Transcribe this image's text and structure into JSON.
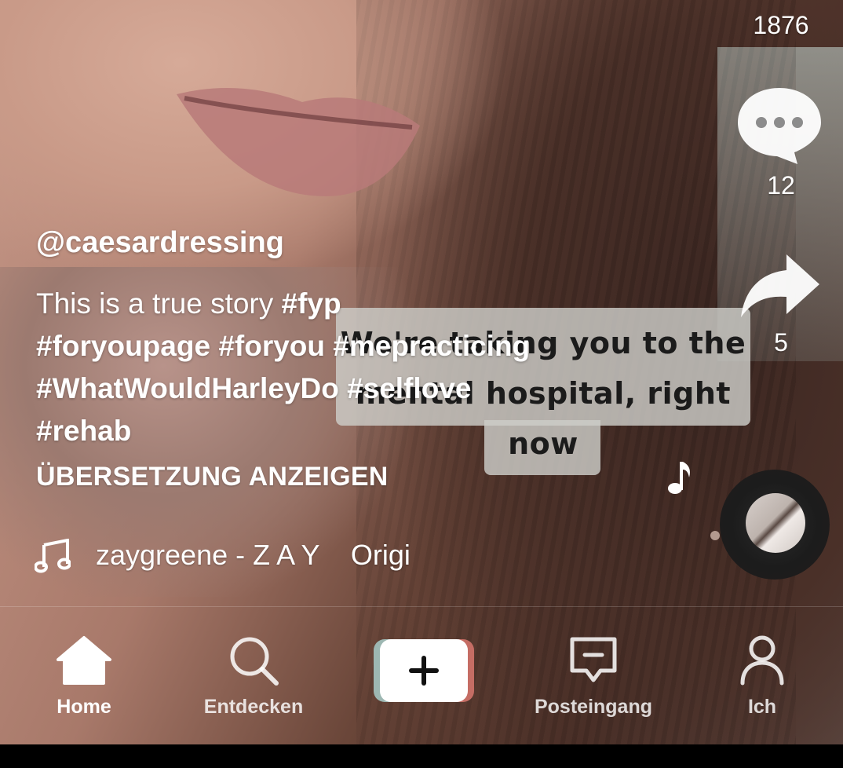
{
  "video": {
    "caption_sticker": {
      "line1": "We're taking you to the",
      "line2": "mental hospital, right",
      "line3": "now"
    }
  },
  "rail": {
    "like_count": "1876",
    "comment_count": "12",
    "share_count": "5"
  },
  "post": {
    "username": "@caesardressing",
    "description_text": "This is a true story ",
    "hashtags": [
      "#fyp",
      "#foryoupage",
      "#foryou",
      "#mepracticing",
      "#WhatWouldHarleyDo",
      "#selflove",
      "#rehab"
    ],
    "translate_label": "ÜBERSETZUNG ANZEIGEN",
    "music": "zaygreene - Z A Y    Origi"
  },
  "nav": {
    "home": "Home",
    "discover": "Entdecken",
    "inbox": "Posteingang",
    "me": "Ich"
  },
  "colors": {
    "create_left": "#9db7b2",
    "create_right": "#c56d64"
  }
}
